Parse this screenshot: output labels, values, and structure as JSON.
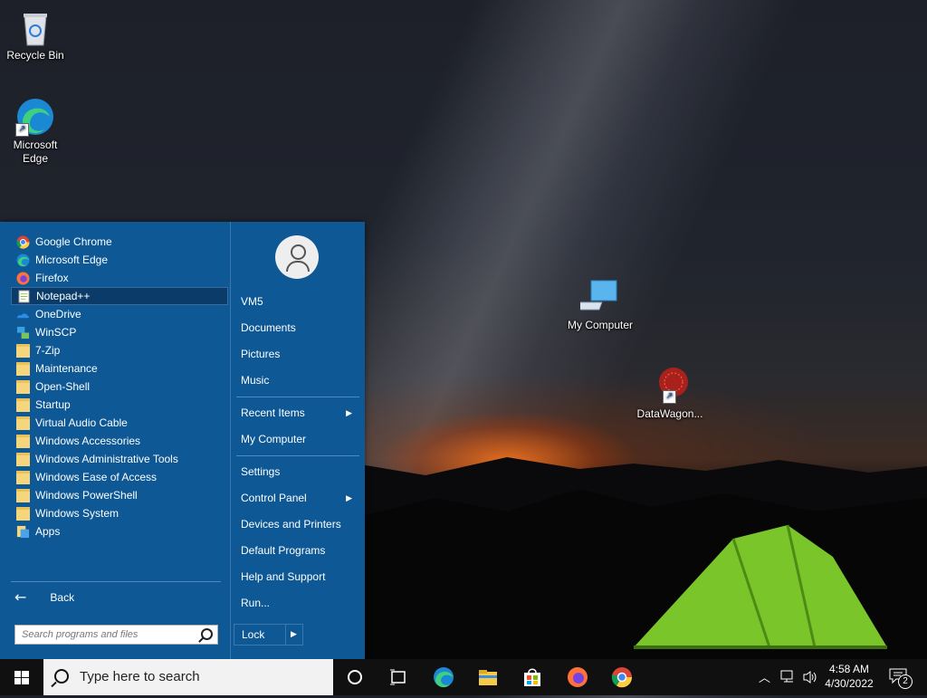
{
  "desktop": {
    "icons": [
      {
        "label": "Recycle Bin",
        "icon": "recycle-bin-icon"
      },
      {
        "label": "Microsoft Edge",
        "icon": "edge-icon"
      },
      {
        "label": "My Computer",
        "icon": "computer-icon"
      },
      {
        "label": "DataWagon...",
        "icon": "datawagon-icon"
      }
    ]
  },
  "start_menu": {
    "programs": [
      {
        "label": "Google Chrome",
        "icon": "chrome-icon"
      },
      {
        "label": "Microsoft Edge",
        "icon": "edge-icon"
      },
      {
        "label": "Firefox",
        "icon": "firefox-icon"
      },
      {
        "label": "Notepad++",
        "icon": "notepad-icon",
        "selected": true
      },
      {
        "label": "OneDrive",
        "icon": "onedrive-icon"
      },
      {
        "label": "WinSCP",
        "icon": "winscp-icon"
      },
      {
        "label": "7-Zip",
        "icon": "folder-icon"
      },
      {
        "label": "Maintenance",
        "icon": "folder-icon"
      },
      {
        "label": "Open-Shell",
        "icon": "folder-icon"
      },
      {
        "label": "Startup",
        "icon": "folder-icon"
      },
      {
        "label": "Virtual Audio Cable",
        "icon": "folder-icon"
      },
      {
        "label": "Windows Accessories",
        "icon": "folder-icon"
      },
      {
        "label": "Windows Administrative Tools",
        "icon": "folder-icon"
      },
      {
        "label": "Windows Ease of Access",
        "icon": "folder-icon"
      },
      {
        "label": "Windows PowerShell",
        "icon": "folder-icon"
      },
      {
        "label": "Windows System",
        "icon": "folder-icon"
      },
      {
        "label": "Apps",
        "icon": "apps-icon"
      }
    ],
    "back_label": "Back",
    "search_placeholder": "Search programs and files",
    "right_items": {
      "user": "VM5",
      "documents": "Documents",
      "pictures": "Pictures",
      "music": "Music",
      "recent_items": "Recent Items",
      "my_computer": "My Computer",
      "settings": "Settings",
      "control_panel": "Control Panel",
      "devices_printers": "Devices and Printers",
      "default_programs": "Default Programs",
      "help_support": "Help and Support",
      "run": "Run..."
    },
    "lock_label": "Lock"
  },
  "taskbar": {
    "search_placeholder": "Type here to search",
    "pinned": [
      "cortana-icon",
      "task-view-icon",
      "edge-icon",
      "file-explorer-icon",
      "store-icon",
      "firefox-icon",
      "chrome-icon"
    ],
    "clock_time": "4:58 AM",
    "clock_date": "4/30/2022",
    "notification_count": "2"
  },
  "colors": {
    "start_menu_bg": "#0d5895",
    "selected_item_bg": "#0b3c69",
    "taskbar_bg": "#101010"
  }
}
